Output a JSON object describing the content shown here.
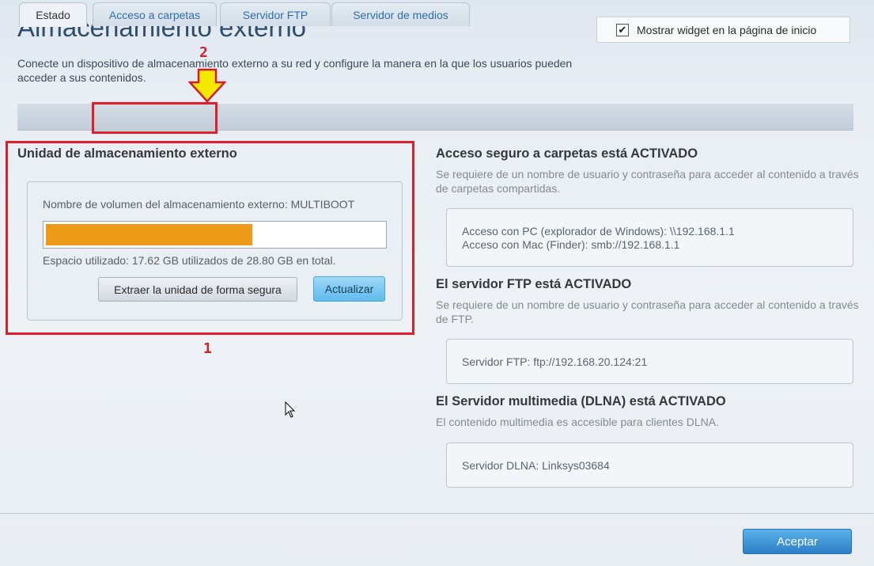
{
  "header": {
    "title": "Almacenamiento externo",
    "description": "Conecte un dispositivo de almacenamiento externo a su red y configure la manera en la que los usuarios pueden acceder a sus contenidos."
  },
  "widget": {
    "label": "Mostrar widget en la página de inicio",
    "checked": true
  },
  "annotations": {
    "marker_1": "1",
    "marker_2": "2",
    "highlight_color": "#e21c2a",
    "arrow_color": "#f4e800"
  },
  "tabs": [
    {
      "label": "Estado",
      "active": true
    },
    {
      "label": "Acceso a carpetas",
      "active": false
    },
    {
      "label": "Servidor FTP",
      "active": false
    },
    {
      "label": "Servidor de medios",
      "active": false
    }
  ],
  "storage": {
    "heading": "Unidad de almacenamiento externo",
    "volume_label": "Nombre de volumen del almacenamiento externo: MULTIBOOT",
    "used_gb": 17.62,
    "total_gb": 28.8,
    "usage_color": "#ec9a17",
    "usage_text": "Espacio utilizado: 17.62 GB utilizados de 28.80 GB en total.",
    "eject_button": "Extraer la unidad de forma segura",
    "refresh_button": "Actualizar"
  },
  "folder_access": {
    "heading": "Acceso seguro a carpetas está ACTIVADO",
    "description": "Se requiere de un nombre de usuario y contraseña para acceder al contenido a través de carpetas compartidas.",
    "pc_line": "Acceso con PC (explorador de Windows): \\\\192.168.1.1",
    "mac_line": "Acceso con Mac (Finder): smb://192.168.1.1"
  },
  "ftp": {
    "heading": "El servidor FTP está ACTIVADO",
    "description": "Se requiere de un nombre de usuario y contraseña para acceder al contenido a través de FTP.",
    "server_line": "Servidor FTP: ftp://192.168.20.124:21"
  },
  "dlna": {
    "heading": "El Servidor multimedia (DLNA) está ACTIVADO",
    "description": "El contenido multimedia es accesible para clientes DLNA.",
    "server_line": "Servidor DLNA: Linksys03684"
  },
  "footer": {
    "accept_button": "Aceptar"
  }
}
